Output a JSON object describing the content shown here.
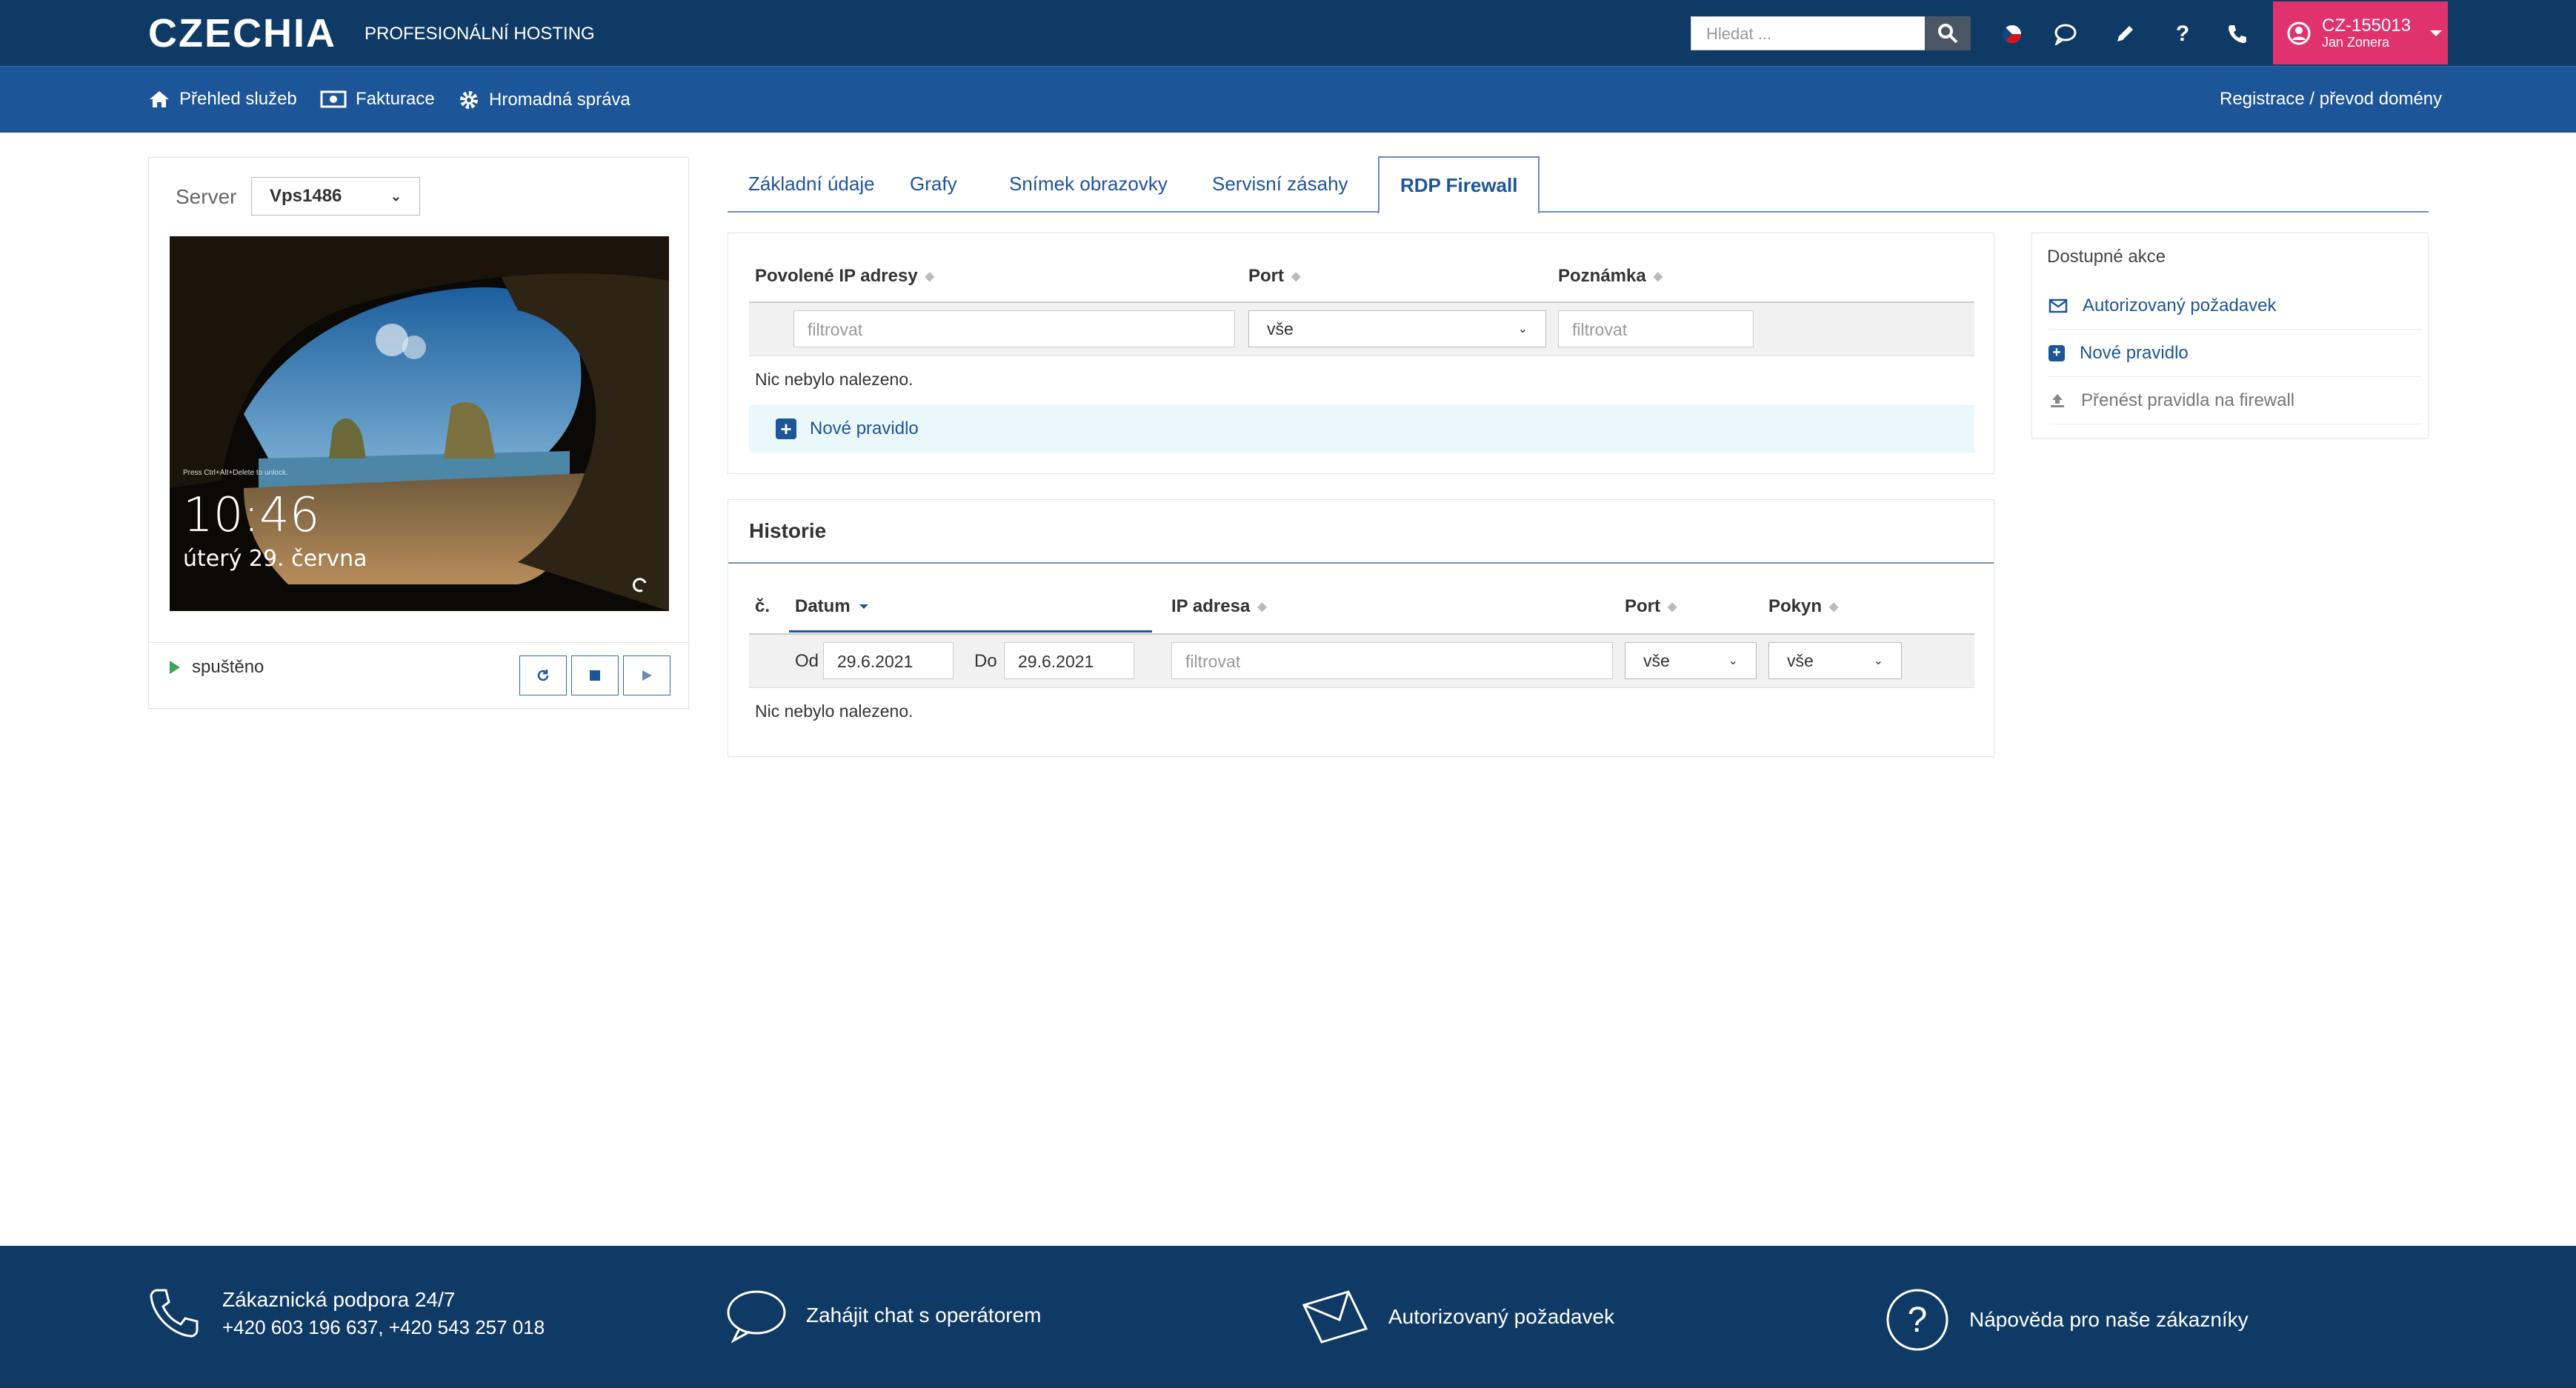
{
  "brand": {
    "logo": "CZECHIA",
    "tagline": "PROFESIONÁLNÍ HOSTING"
  },
  "search": {
    "placeholder": "Hledat ..."
  },
  "user": {
    "id": "CZ-155013",
    "name": "Jan Zonera"
  },
  "nav": {
    "items": [
      {
        "label": "Přehled služeb",
        "icon": "home-icon"
      },
      {
        "label": "Fakturace",
        "icon": "money-icon"
      },
      {
        "label": "Hromadná správa",
        "icon": "gear-icon"
      }
    ],
    "right_link": "Registrace / převod domény"
  },
  "server": {
    "label": "Server",
    "selected": "Vps1486",
    "screen_hint": "Press Ctrl+Alt+Delete to unlock.",
    "screen_time": "10:46",
    "screen_date": "úterý 29. června",
    "status": "spuštěno"
  },
  "tabs": [
    {
      "label": "Základní údaje"
    },
    {
      "label": "Grafy"
    },
    {
      "label": "Snímek obrazovky"
    },
    {
      "label": "Servisní zásahy"
    },
    {
      "label": "RDP Firewall",
      "active": true
    }
  ],
  "firewall": {
    "headers": [
      "Povolené IP adresy",
      "Port",
      "Poznámka"
    ],
    "filter_ip_placeholder": "filtrovat",
    "filter_port_value": "vše",
    "filter_note_placeholder": "filtrovat",
    "empty": "Nic nebylo nalezeno.",
    "new_rule": "Nové pravidlo"
  },
  "actions": {
    "title": "Dostupné akce",
    "items": [
      {
        "label": "Autorizovaný požadavek",
        "icon": "envelope-icon"
      },
      {
        "label": "Nové pravidlo",
        "icon": "plus-square-icon"
      },
      {
        "label": "Přenést pravidla na firewall",
        "icon": "upload-icon"
      }
    ]
  },
  "history": {
    "title": "Historie",
    "headers": [
      "č.",
      "Datum",
      "IP adresa",
      "Port",
      "Pokyn"
    ],
    "from_label": "Od",
    "from_value": "29.6.2021",
    "to_label": "Do",
    "to_value": "29.6.2021",
    "ip_placeholder": "filtrovat",
    "port_value": "vše",
    "command_value": "vše",
    "empty": "Nic nebylo nalezeno."
  },
  "footer": {
    "support_title": "Zákaznická podpora 24/7",
    "support_phones": "+420 603 196 637, +420 543 257 018",
    "chat": "Zahájit chat s operátorem",
    "authorized": "Autorizovaný požadavek",
    "help": "Nápověda pro naše zákazníky"
  },
  "colors": {
    "topbar": "#0f3a66",
    "navbar": "#1d5599",
    "accent": "#e0336e",
    "link": "#1d5599",
    "status_green": "#3aa655"
  }
}
